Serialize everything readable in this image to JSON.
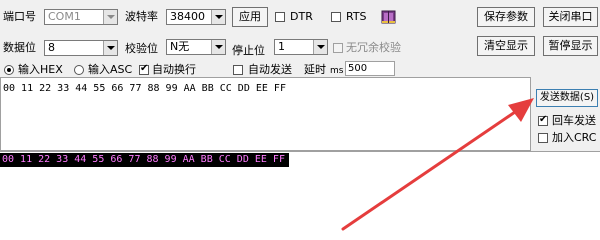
{
  "serial": {
    "port_label": "端口号",
    "port_value": "COM1",
    "baud_label": "波特率",
    "baud_value": "38400",
    "apply_button": "应用",
    "dtr_label": "DTR",
    "rts_label": "RTS",
    "databits_label": "数据位",
    "databits_value": "8",
    "parity_label": "校验位",
    "parity_value": "N无",
    "stopbits_label": "停止位",
    "stopbits_value": "1",
    "no_redundant_label": "无冗余校验"
  },
  "buttons": {
    "save_params": "保存参数",
    "close_port": "关闭串口",
    "clear_display": "清空显示",
    "pause_display": "暂停显示",
    "send_data": "发送数据(S)"
  },
  "options": {
    "input_hex": "输入HEX",
    "input_asc": "输入ASC",
    "auto_wrap": "自动换行",
    "auto_send": "自动发送",
    "delay_label": "延时",
    "delay_unit": "ms",
    "delay_value": "500",
    "carriage_return_send": "回车发送",
    "add_crc": "加入CRC"
  },
  "send_area": {
    "text": "00 11 22 33 44 55 66 77 88 99 AA BB CC DD EE FF"
  },
  "receive_area": {
    "text": "00 11 22 33 44 55 66 77 88 99 AA BB CC DD EE FF"
  },
  "colors": {
    "receive_bg": "#000000",
    "receive_fg": "#ff7cff",
    "arrow": "#e53d3d"
  }
}
